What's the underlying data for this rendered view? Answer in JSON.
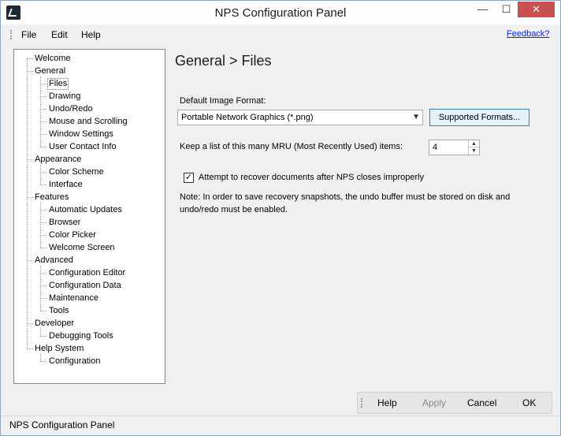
{
  "window": {
    "title": "NPS Configuration Panel"
  },
  "window_controls": {
    "minimize": "—",
    "maximize": "☐",
    "close": "✕"
  },
  "menu": {
    "file": "File",
    "edit": "Edit",
    "help": "Help",
    "feedback": "Feedback?"
  },
  "tree": {
    "welcome": "Welcome",
    "general": "General",
    "general_children": [
      "Files",
      "Drawing",
      "Undo/Redo",
      "Mouse and Scrolling",
      "Window Settings",
      "User Contact Info"
    ],
    "appearance": "Appearance",
    "appearance_children": [
      "Color Scheme",
      "Interface"
    ],
    "features": "Features",
    "features_children": [
      "Automatic Updates",
      "Browser",
      "Color Picker",
      "Welcome Screen"
    ],
    "advanced": "Advanced",
    "advanced_children": [
      "Configuration Editor",
      "Configuration Data",
      "Maintenance",
      "Tools"
    ],
    "developer": "Developer",
    "developer_children": [
      "Debugging Tools"
    ],
    "help_system": "Help System",
    "help_system_children": [
      "Configuration"
    ],
    "selected": "Files"
  },
  "content": {
    "title": "General > Files",
    "image_format_label": "Default Image Format:",
    "image_format_value": "Portable Network Graphics (*.png)",
    "supported_formats_button": "Supported Formats...",
    "mru_label": "Keep a list of this many MRU (Most Recently Used) items:",
    "mru_value": "4",
    "recover_checkbox_label": "Attempt to recover documents after NPS closes improperly",
    "recover_checked": true,
    "note": "Note: In order to save recovery snapshots, the undo buffer must be stored on disk and undo/redo must be enabled."
  },
  "buttons": {
    "help": "Help",
    "apply": "Apply",
    "cancel": "Cancel",
    "ok": "OK"
  },
  "status": {
    "text": "NPS Configuration Panel"
  }
}
